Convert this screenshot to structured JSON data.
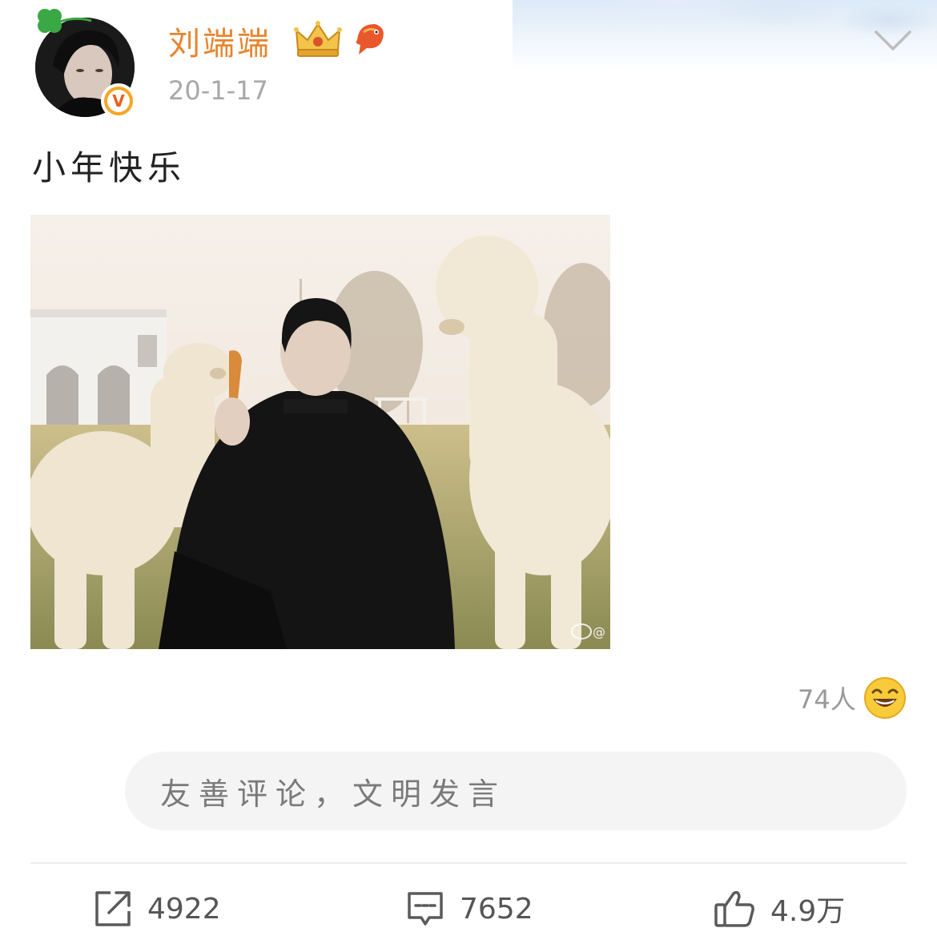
{
  "header": {
    "user_name": "刘端端",
    "post_time": "20-1-17",
    "verified_label": "V",
    "icons": [
      "clover-icon",
      "crown-icon",
      "fish-icon",
      "chevron-down-icon",
      "verified-icon"
    ]
  },
  "post": {
    "text": "小年快乐",
    "image_watermark": "@"
  },
  "reactions": {
    "count_text": "74人",
    "emoji": "laugh-emoji-icon"
  },
  "comment_box": {
    "placeholder": "友善评论，文明发言"
  },
  "actions": {
    "repost_count": "4922",
    "comment_count": "7652",
    "like_count": "4.9万"
  },
  "colors": {
    "name_orange": "#e8842b",
    "badge_orange": "#f5a623",
    "muted_gray": "#a8a8a8"
  }
}
